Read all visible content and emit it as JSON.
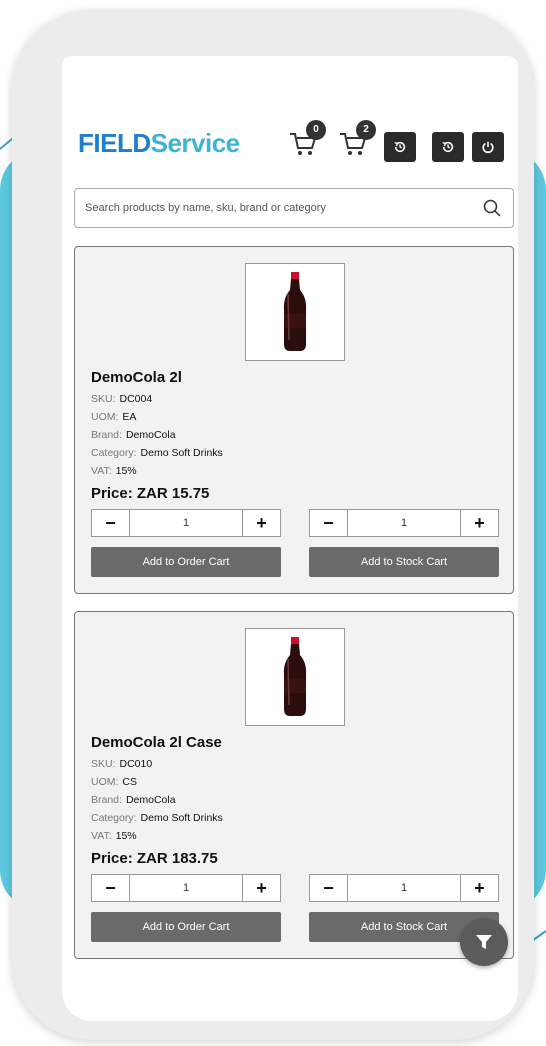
{
  "app": {
    "logo_part1": "FIELD",
    "logo_part2": "Service"
  },
  "header": {
    "cart1_count": "0",
    "cart2_count": "2",
    "icons": [
      "cart-icon",
      "cart-icon",
      "history-icon",
      "history-icon",
      "power-icon"
    ]
  },
  "search": {
    "placeholder": "Search products by name, sku, brand or category"
  },
  "labels": {
    "sku": "SKU:",
    "uom": "UOM:",
    "brand": "Brand:",
    "category": "Category:",
    "vat": "VAT:",
    "minus": "−",
    "plus": "+",
    "add_order": "Add to Order Cart",
    "add_stock": "Add to Stock Cart"
  },
  "products": [
    {
      "name": "DemoCola 2l",
      "sku": "DC004",
      "uom": "EA",
      "brand": "DemoCola",
      "category": "Demo Soft Drinks",
      "vat": "15%",
      "price": "Price: ZAR 15.75",
      "order_qty": "1",
      "stock_qty": "1"
    },
    {
      "name": "DemoCola 2l Case",
      "sku": "DC010",
      "uom": "CS",
      "brand": "DemoCola",
      "category": "Demo Soft Drinks",
      "vat": "15%",
      "price": "Price: ZAR 183.75",
      "order_qty": "1",
      "stock_qty": "1"
    }
  ],
  "colors": {
    "brand_blue": "#1f7fc8",
    "brand_cyan": "#3fb3d6",
    "background_band": "#5cc8de",
    "button_gray": "#6a6a6a",
    "icon_button_dark": "#2a2a2a"
  }
}
